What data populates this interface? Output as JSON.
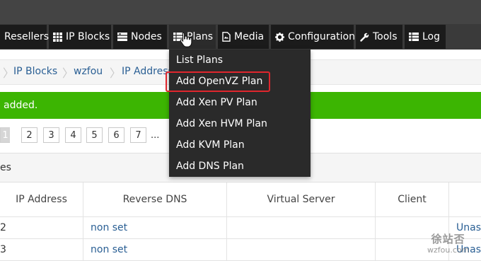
{
  "navbar": {
    "items": [
      {
        "label": "Resellers",
        "icon": "none"
      },
      {
        "label": "IP Blocks",
        "icon": "grid-icon"
      },
      {
        "label": "Nodes",
        "icon": "server-icon"
      },
      {
        "label": "Plans",
        "icon": "list-icon"
      },
      {
        "label": "Media",
        "icon": "file-icon"
      },
      {
        "label": "Configuration",
        "icon": "gear-icon"
      },
      {
        "label": "Tools",
        "icon": "wrench-icon"
      },
      {
        "label": "Log",
        "icon": "log-icon"
      }
    ],
    "active": "Plans"
  },
  "plans_menu": {
    "items": [
      "List Plans",
      "Add OpenVZ Plan",
      "Add Xen PV Plan",
      "Add Xen HVM Plan",
      "Add KVM Plan",
      "Add DNS Plan"
    ],
    "highlighted": "Add OpenVZ Plan"
  },
  "breadcrumb": {
    "items": [
      "IP Blocks",
      "wzfou",
      "IP Address"
    ]
  },
  "alert": {
    "message": "added."
  },
  "pagination": {
    "pages": [
      "1",
      "2",
      "3",
      "4",
      "5",
      "6",
      "7"
    ],
    "current": "1",
    "ellipsis": "..."
  },
  "panel": {
    "title": "es"
  },
  "table": {
    "columns": [
      "IP Address",
      "Reverse DNS",
      "Virtual Server",
      "Client",
      ""
    ],
    "rows": [
      {
        "ip": "2",
        "rdns": "non set",
        "server": "",
        "client": "",
        "action": "Unass"
      },
      {
        "ip": "3",
        "rdns": "non set",
        "server": "",
        "client": "",
        "action": "Unass"
      }
    ]
  },
  "watermark": {
    "line1": "徐站否",
    "line2": "wzfou.com"
  },
  "colors": {
    "navbar_bg": "#1b1b1b",
    "alert_green": "#3cb502",
    "highlight_red": "#e0262d",
    "link_blue": "#2a5f94"
  }
}
